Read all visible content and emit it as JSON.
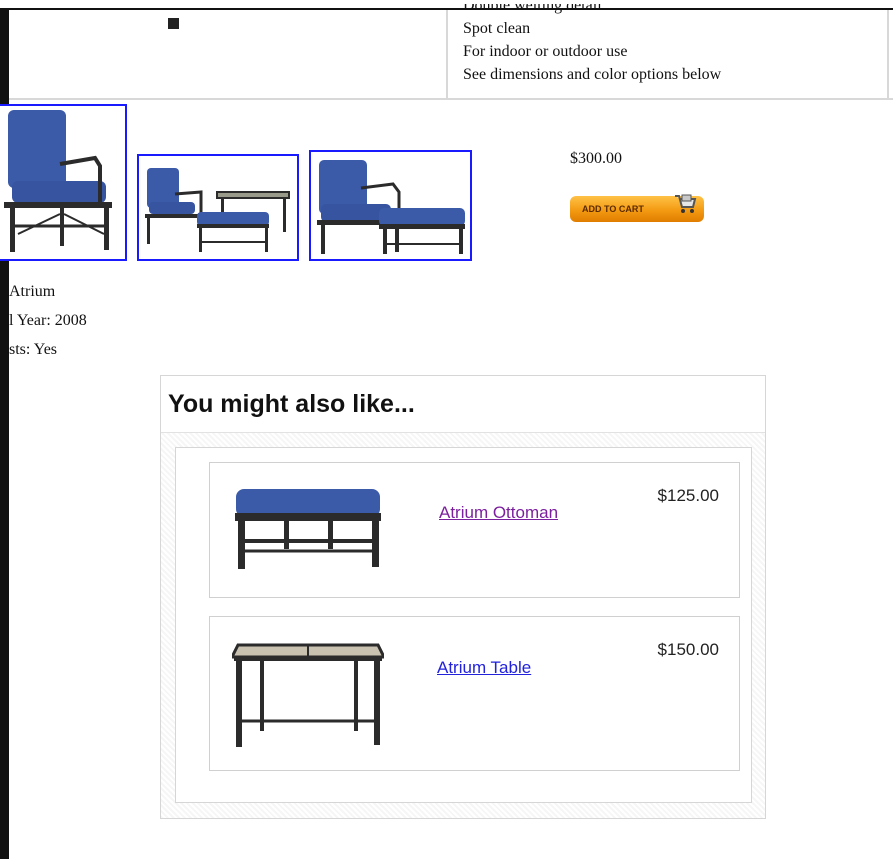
{
  "features": {
    "cut_line": "Double welting detail",
    "lines": [
      "Spot clean",
      "For indoor or outdoor use",
      "See dimensions and color options below"
    ]
  },
  "product": {
    "price": "$300.00",
    "add_to_cart": "ADD TO CART"
  },
  "attributes": [
    "Atrium",
    "l Year: 2008",
    "sts: Yes"
  ],
  "recommendations": {
    "title": "You might also like...",
    "items": [
      {
        "name": "Atrium Ottoman",
        "price": "$125.00"
      },
      {
        "name": "Atrium Table",
        "price": "$150.00"
      }
    ]
  },
  "colors": {
    "cushion": "#3b5aa8",
    "frame": "#2b2b2b",
    "thumb_border": "#1a1aff",
    "button": "#f39a12"
  }
}
